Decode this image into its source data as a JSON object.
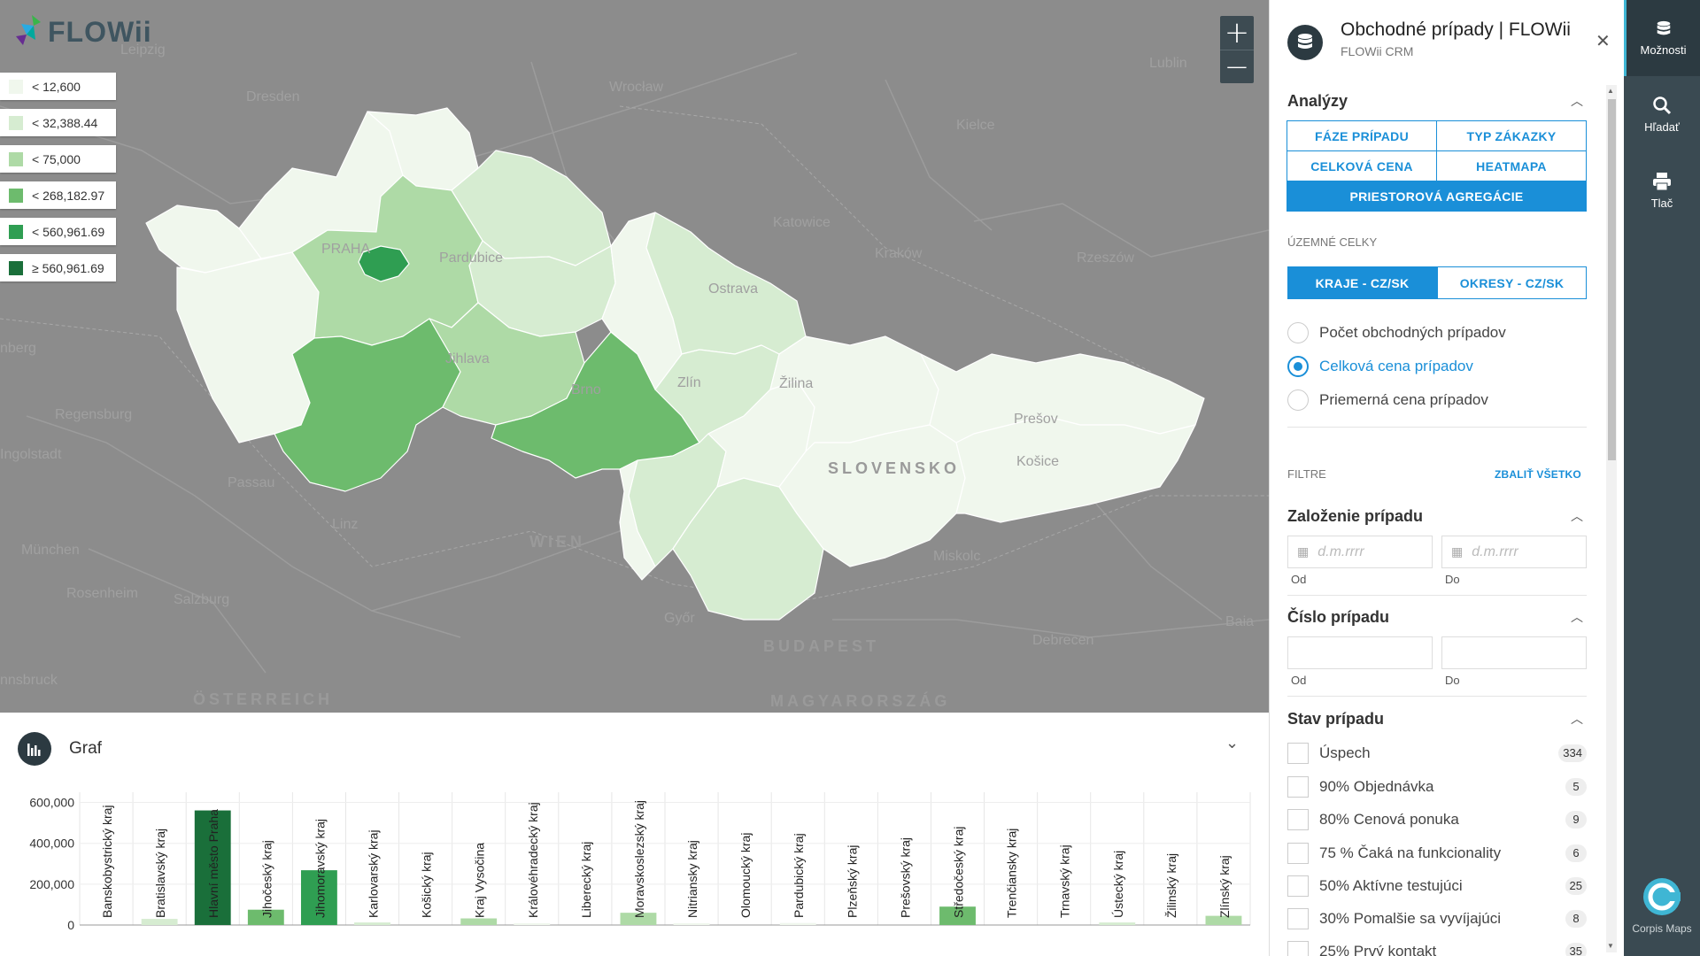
{
  "app": {
    "logo_text": "FLOWii"
  },
  "map": {
    "legend": [
      {
        "label": "< 12,600",
        "color": "#f0f7ed"
      },
      {
        "label": "< 32,388.44",
        "color": "#d6ecd1"
      },
      {
        "label": "< 75,000",
        "color": "#aedaa6"
      },
      {
        "label": "< 268,182.97",
        "color": "#6dbb6d"
      },
      {
        "label": "< 560,961.69",
        "color": "#2f9e52"
      },
      {
        "label": "≥ 560,961.69",
        "color": "#1a6f3a"
      }
    ],
    "place_labels": {
      "leipzig": "Leipzig",
      "dresden": "Dresden",
      "wroclaw": "Wrocław",
      "lublin": "Lublin",
      "kielce": "Kielce",
      "katowice": "Katowice",
      "krakow": "Kraków",
      "rzeszow": "Rzeszów",
      "praha": "PRAHA",
      "pardubice": "Pardubice",
      "ostrava": "Ostrava",
      "jihlava": "Jihlava",
      "brno": "Brno",
      "zlin": "Zlín",
      "zilina": "Žilina",
      "presov": "Prešov",
      "kosice": "Košice",
      "slovensko": "SLOVENSKO",
      "nberg": "nberg",
      "regensburg": "Regensburg",
      "ingolstadt": "Ingolstadt",
      "passau": "Passau",
      "linz": "Linz",
      "wien": "WIEN",
      "munchen": "München",
      "rosenheim": "Rosenheim",
      "salzburg": "Salzburg",
      "gyor": "Győr",
      "budapest": "BUDAPEST",
      "miskolc": "Miskolc",
      "debrecen": "Debrecen",
      "baia": "Baia",
      "innsbruck": "nnsbruck",
      "osterreich": "ÖSTERREICH",
      "magyarorszag": "MAGYARORSZÁG"
    },
    "zoom_in": "+",
    "zoom_out": "−"
  },
  "chart_panel": {
    "title": "Graf",
    "collapse_icon": "chevron-down-icon"
  },
  "chart_data": {
    "type": "bar",
    "categories": [
      "Banskobystrický kraj",
      "Bratislavský kraj",
      "Hlavní město Praha",
      "Jihočeský kraj",
      "Jihomoravský kraj",
      "Karlovarský kraj",
      "Košický kraj",
      "Kraj Vysočina",
      "Královéhradecký kraj",
      "Liberecký kraj",
      "Moravskoslezský kraj",
      "Nitriansky kraj",
      "Olomoucký kraj",
      "Pardubický kraj",
      "Plzeňský kraj",
      "Prešovský kraj",
      "Středočeský kraj",
      "Trenčiansky kraj",
      "Trnavský kraj",
      "Ústecký kraj",
      "Žilinský kraj",
      "Zlínský kraj"
    ],
    "values": [
      0,
      30000,
      560961.69,
      75000,
      268182.97,
      12600,
      0,
      32388.44,
      5000,
      0,
      60000,
      8000,
      0,
      10000,
      0,
      0,
      90000,
      0,
      0,
      12600,
      0,
      45000
    ],
    "ylim": [
      0,
      650000
    ],
    "yticks": [
      "0",
      "200,000",
      "400,000",
      "600,000"
    ],
    "ytick_values": [
      0,
      200000,
      400000,
      600000
    ],
    "grid": true
  },
  "side": {
    "title": "Obchodné prípady | FLOWii",
    "subtitle": "FLOWii CRM",
    "analyzy": {
      "title": "Analýzy",
      "buttons": [
        "FÁZE PRÍPADU",
        "TYP ZÁKAZKY",
        "CELKOVÁ CENA",
        "HEATMAPA",
        "PRIESTOROVÁ AGREGÁCIE"
      ]
    },
    "uzemne": {
      "label": "ÚZEMNÉ CELKY",
      "options": [
        "KRAJE - CZ/SK",
        "OKRESY - CZ/SK"
      ]
    },
    "metrics": [
      "Počet obchodných prípadov",
      "Celková cena prípadov",
      "Priemerná cena prípadov"
    ],
    "filtre": {
      "label": "FILTRE",
      "collapse_all": "ZBALIŤ VŠETKO"
    },
    "zalozenie": {
      "title": "Založenie prípadu",
      "from_placeholder": "d.m.rrrr",
      "to_placeholder": "d.m.rrrr",
      "from_label": "Od",
      "to_label": "Do"
    },
    "cislo": {
      "title": "Číslo prípadu",
      "from_label": "Od",
      "to_label": "Do"
    },
    "stav": {
      "title": "Stav prípadu",
      "items": [
        {
          "label": "Úspech",
          "count": "334"
        },
        {
          "label": "90% Objednávka",
          "count": "5"
        },
        {
          "label": "80% Cenová ponuka",
          "count": "9"
        },
        {
          "label": "75 % Čaká na funkcionality",
          "count": "6"
        },
        {
          "label": "50% Aktívne testujúci",
          "count": "25"
        },
        {
          "label": "30% Pomalšie sa vyvíjajúci",
          "count": "8"
        },
        {
          "label": "25% Prvý kontakt",
          "count": "35"
        }
      ]
    }
  },
  "rail": {
    "items": [
      "Možnosti",
      "Hľadať",
      "Tlač"
    ],
    "brand": "Corpis Maps"
  },
  "colors": {
    "accent": "#1a8fd8",
    "rail": "#3a4a52",
    "map_bg": "#8c8c8c"
  }
}
